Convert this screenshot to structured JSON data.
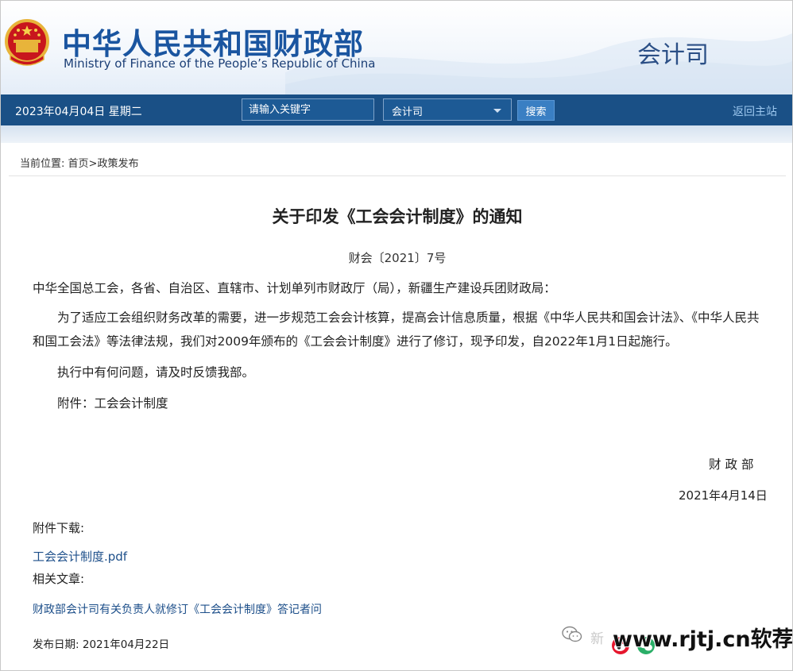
{
  "header": {
    "title_cn": "中华人民共和国财政部",
    "title_en": "Ministry of Finance of the People’s Republic of China",
    "department": "会计司"
  },
  "nav": {
    "date": "2023年04月04日  星期二",
    "search_placeholder": "请输入关键字",
    "select_value": "会计司",
    "search_button": "搜索",
    "home_link": "返回主站"
  },
  "breadcrumb": {
    "prefix": "当前位置:",
    "home": "首页",
    "separator": ">",
    "current": "政策发布"
  },
  "article": {
    "title": "关于印发《工会会计制度》的通知",
    "doc_number": "财会〔2021〕7号",
    "salutation": "中华全国总工会，各省、自治区、直辖市、计划单列市财政厅（局），新疆生产建设兵团财政局：",
    "paragraph_main": "为了适应工会组织财务改革的需要，进一步规范工会会计核算，提高会计信息质量，根据《中华人民共和国会计法》、《中华人民共和国工会法》等法律法规，我们对2009年颁布的《工会会计制度》进行了修订，现予印发，自2022年1月1日起施行。",
    "paragraph_feedback": "执行中有何问题，请及时反馈我部。",
    "attachment_line": "附件：工会会计制度",
    "signer": "财政部",
    "sign_date": "2021年4月14日"
  },
  "attachments": {
    "heading": "附件下载:",
    "file_link": "工会会计制度.pdf"
  },
  "related": {
    "heading": "相关文章:",
    "link": "财政部会计司有关负责人就修订《工会会计制度》答记者问"
  },
  "publish": {
    "label": "发布日期:",
    "date": "2021年04月22日"
  },
  "watermark": {
    "faded_text": "新",
    "site_text": "www.rjtj.cn软荐网"
  },
  "colors": {
    "nav_bar": "#1a5086",
    "title_blue": "#1a55a0",
    "link_blue": "#1d4f8a"
  }
}
